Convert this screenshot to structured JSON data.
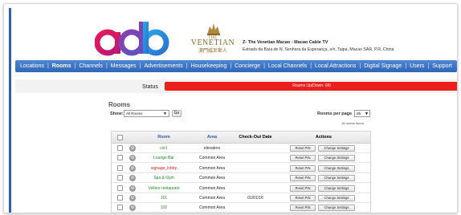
{
  "header": {
    "logo_text": "adb",
    "venetian_title": "VENETIAN",
    "venetian_the": "THE",
    "venetian_sub": "澳門威尼斯人",
    "site_name": "Z- The Venetian Macao - Macao Cable TV",
    "site_address": "Estrada da Baía de N. Senhora da Esperança, s/n, Taipa, Macao SAR, P.R. China"
  },
  "nav": {
    "items": [
      {
        "label": "Locations",
        "active": false
      },
      {
        "label": "Rooms",
        "active": true
      },
      {
        "label": "Channels",
        "active": false
      },
      {
        "label": "Messages",
        "active": false
      },
      {
        "label": "Advertisements",
        "active": false
      },
      {
        "label": "Housekeeping",
        "active": false
      },
      {
        "label": "Concierge",
        "active": false
      },
      {
        "label": "Local Channels",
        "active": false
      },
      {
        "label": "Local Attractions",
        "active": false
      },
      {
        "label": "Digital Signage",
        "active": false
      },
      {
        "label": "Users",
        "active": false
      },
      {
        "label": "Support",
        "active": false
      }
    ]
  },
  "status": {
    "label": "Status",
    "message": "Rooms Up/Down: 0/0",
    "color": "#ec1f1f"
  },
  "rooms": {
    "title": "Rooms",
    "show_label": "Show:",
    "show_value": "All Rooms",
    "go_label": "Go",
    "rooms_per_page_label": "Rooms per page",
    "rooms_per_page_value": "25",
    "count_text": "15 rooms found"
  },
  "table": {
    "headers": {
      "room": "Room",
      "area": "Area",
      "checkout": "Check-Out Date",
      "actions": "Actions"
    },
    "reset_label": "Reset PIN",
    "change_label": "Change Settings",
    "rows": [
      {
        "room": "cor1",
        "room_color": "green",
        "area": "elevators",
        "checkout": ""
      },
      {
        "room": "Lounge Bar",
        "room_color": "green",
        "area": "Common Area",
        "checkout": ""
      },
      {
        "room": "signage_lobby",
        "room_color": "red",
        "area": "Common Area",
        "checkout": ""
      },
      {
        "room": "Spa & Gym",
        "room_color": "green",
        "area": "Common Area",
        "checkout": ""
      },
      {
        "room": "Vellore restaurant",
        "room_color": "green",
        "area": "Common Area",
        "checkout": ""
      },
      {
        "room": "101",
        "room_color": "green",
        "area": "Common Area",
        "checkout": "01/01/16"
      },
      {
        "room": "102",
        "room_color": "green",
        "area": "Common Area",
        "checkout": ""
      }
    ]
  }
}
